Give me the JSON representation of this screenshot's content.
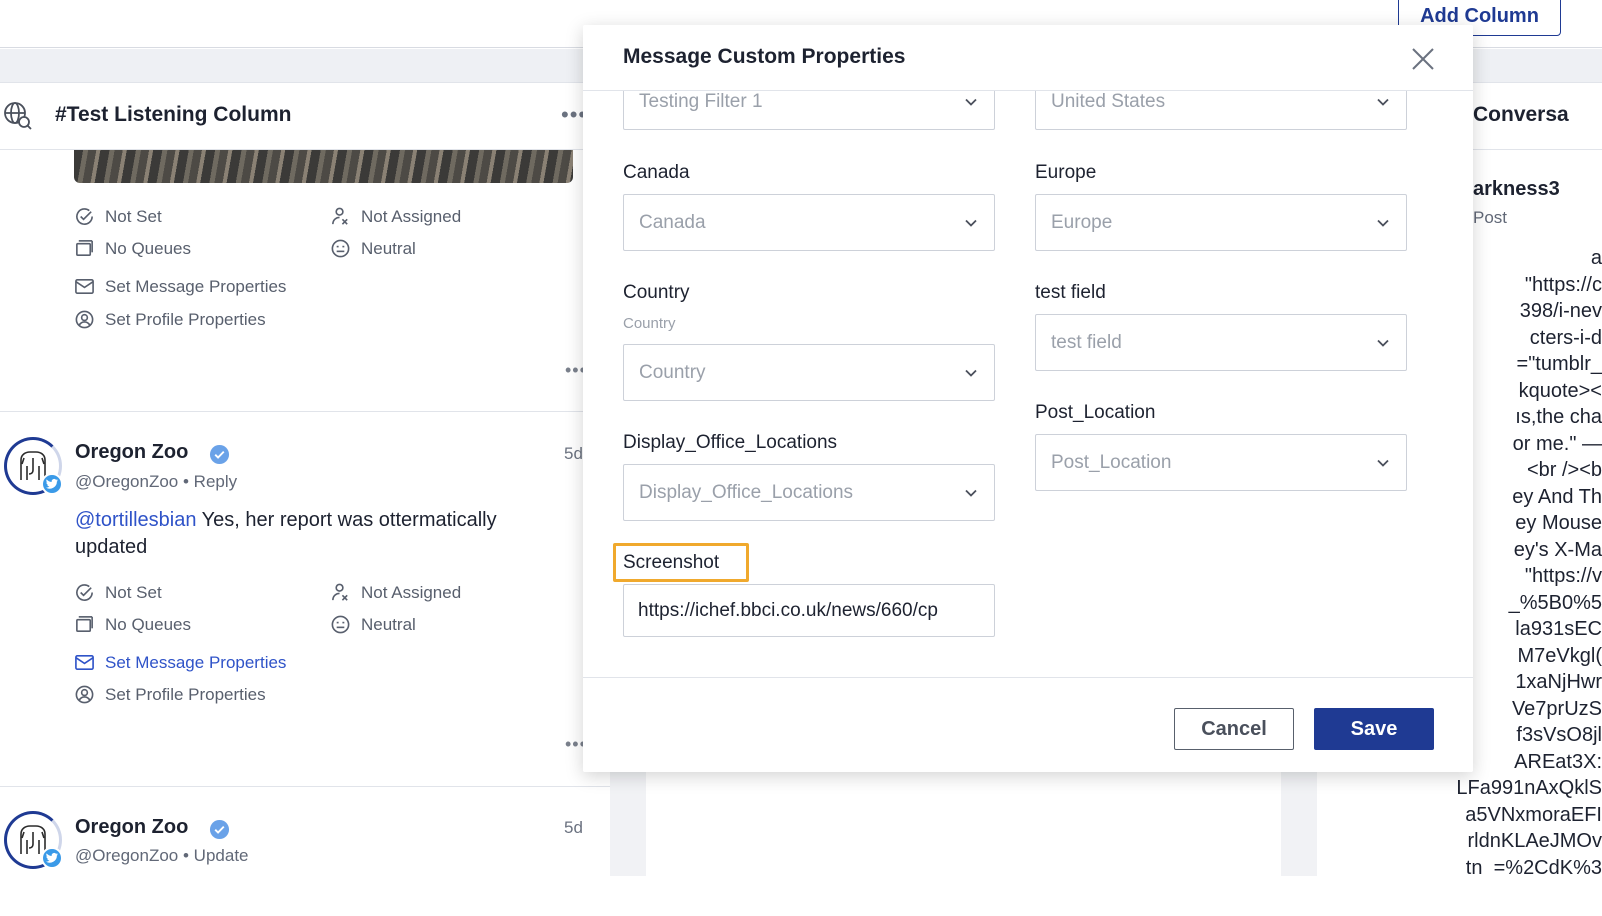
{
  "toolbar": {
    "add_column_label": "Add Column"
  },
  "listening_column": {
    "title": "#Test Listening Column",
    "menu": "•••",
    "first_card": {
      "status": "Not Set",
      "queues": "No Queues",
      "assignee": "Not Assigned",
      "sentiment": "Neutral",
      "set_message_properties": "Set Message Properties",
      "set_profile_properties": "Set Profile Properties"
    },
    "second_card": {
      "author": "Oregon Zoo",
      "handle": "@OregonZoo",
      "kind": "Reply",
      "age": "5d",
      "mention": "@tortillesbian",
      "text": " Yes, her report was ottermatically updated",
      "status": "Not Set",
      "queues": "No Queues",
      "assignee": "Not Assigned",
      "sentiment": "Neutral",
      "set_message_properties": "Set Message Properties",
      "set_profile_properties": "Set Profile Properties"
    },
    "third_card": {
      "author": "Oregon Zoo",
      "handle": "@OregonZoo",
      "kind": "Update",
      "age": "5d"
    }
  },
  "right_column": {
    "title": "Conversa",
    "name": "arkness3",
    "sub": "Post",
    "code_lines": [
      "a",
      "\"https://c",
      "398/i-nev",
      "cters-i-d",
      "=\"tumblr_",
      "kquote><",
      "ıs,the cha",
      "or me.\" —",
      "<br /><b",
      "ey And Th",
      "ey Mouse",
      "ey's X-Ma",
      "\"https://v",
      "_%5B0%5",
      "la931sEC",
      "M7eVkgl(",
      "1xaNjHwr",
      "Ve7prUzS",
      "f3sVsO8jl",
      "AREat3X:",
      "LFa991nAxQklS",
      "a5VNxmoraEFI",
      "rldnKLAeJMOv",
      "tn_=%2CdK%3"
    ]
  },
  "modal": {
    "title": "Message Custom Properties",
    "fields": {
      "testing_filter": {
        "placeholder": "Testing Filter 1"
      },
      "united_states": {
        "placeholder": "United States"
      },
      "canada": {
        "label": "Canada",
        "placeholder": "Canada"
      },
      "europe": {
        "label": "Europe",
        "placeholder": "Europe"
      },
      "country": {
        "label": "Country",
        "hint": "Country",
        "placeholder": "Country"
      },
      "test_field": {
        "label": "test field",
        "placeholder": "test field"
      },
      "post_location": {
        "label": "Post_Location",
        "placeholder": "Post_Location"
      },
      "display_office_locations": {
        "label": "Display_Office_Locations",
        "placeholder": "Display_Office_Locations"
      },
      "screenshot": {
        "label": "Screenshot",
        "value": "https://ichef.bbci.co.uk/news/660/cp"
      }
    },
    "cancel_label": "Cancel",
    "save_label": "Save"
  },
  "colors": {
    "brand": "#1f3a93",
    "link": "#2f53c8",
    "highlight": "#f0a92d"
  }
}
